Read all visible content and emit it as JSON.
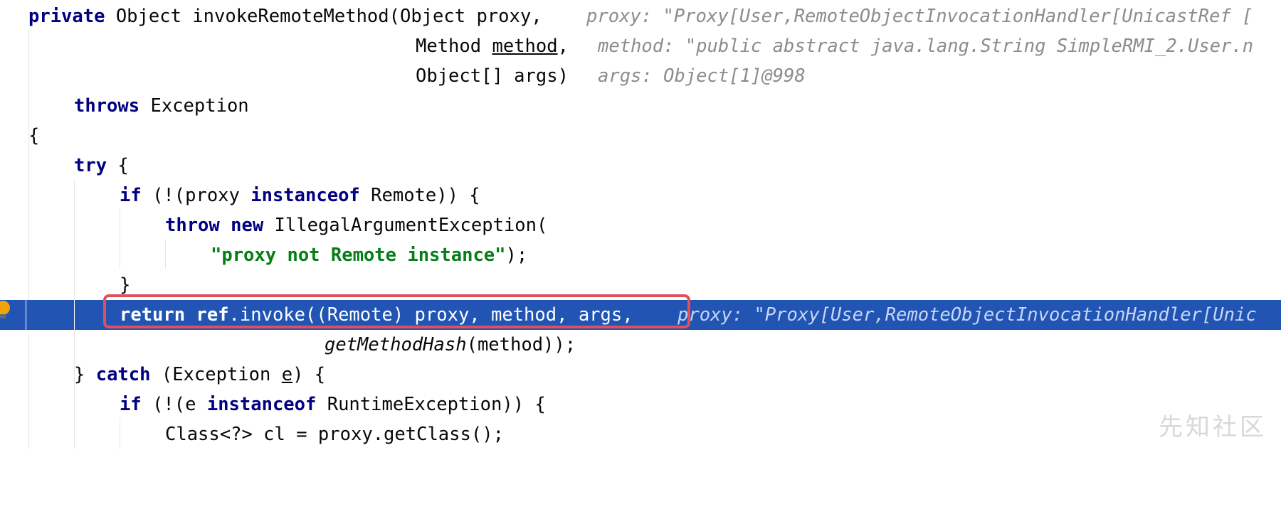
{
  "code": {
    "line1": {
      "kw": "private",
      "sig": " Object invokeRemoteMethod(Object proxy,",
      "hint": "proxy: \"Proxy[User,RemoteObjectInvocationHandler[UnicastRef ["
    },
    "line2": {
      "pre": "Method ",
      "param": "method",
      "post": ",",
      "hint": "method: \"public abstract java.lang.String SimpleRMI_2.User.n"
    },
    "line3": {
      "text": "Object[] args)",
      "hint": "args: Object[1]@998"
    },
    "line4": {
      "kw": "throws",
      "text": " Exception"
    },
    "line5": {
      "text": "{"
    },
    "line6": {
      "kw": "try",
      "text": " {"
    },
    "line7": {
      "kw1": "if",
      "t1": " (!(proxy ",
      "kw2": "instanceof",
      "t2": " Remote)) {"
    },
    "line8": {
      "kw1": "throw",
      "sp": " ",
      "kw2": "new",
      "t": " IllegalArgumentException("
    },
    "line9": {
      "str": "\"proxy not Remote instance\"",
      "t": ");"
    },
    "line10": {
      "text": "}"
    },
    "line11": {
      "kw1": "return",
      "sp": " ",
      "kw2": "ref",
      "t": ".invoke((Remote) proxy, method, args,",
      "hint": "proxy: \"Proxy[User,RemoteObjectInvocationHandler[Unic"
    },
    "line12": {
      "it": "getMethodHash",
      "t": "(method));"
    },
    "line13": {
      "t1": "} ",
      "kw": "catch",
      "t2": " (Exception ",
      "var": "e",
      "t3": ") {"
    },
    "line14": {
      "kw1": "if",
      "t1": " (!(e ",
      "kw2": "instanceof",
      "t2": " RuntimeException)) {"
    },
    "line15": {
      "text": "Class<?> cl = proxy.getClass();"
    }
  },
  "watermark": "先知社区",
  "colors": {
    "keyword": "#000080",
    "string": "#067d17",
    "hint": "#8c8c8c",
    "execution_line": "#2154b3",
    "highlight_box": "#e0505a"
  }
}
